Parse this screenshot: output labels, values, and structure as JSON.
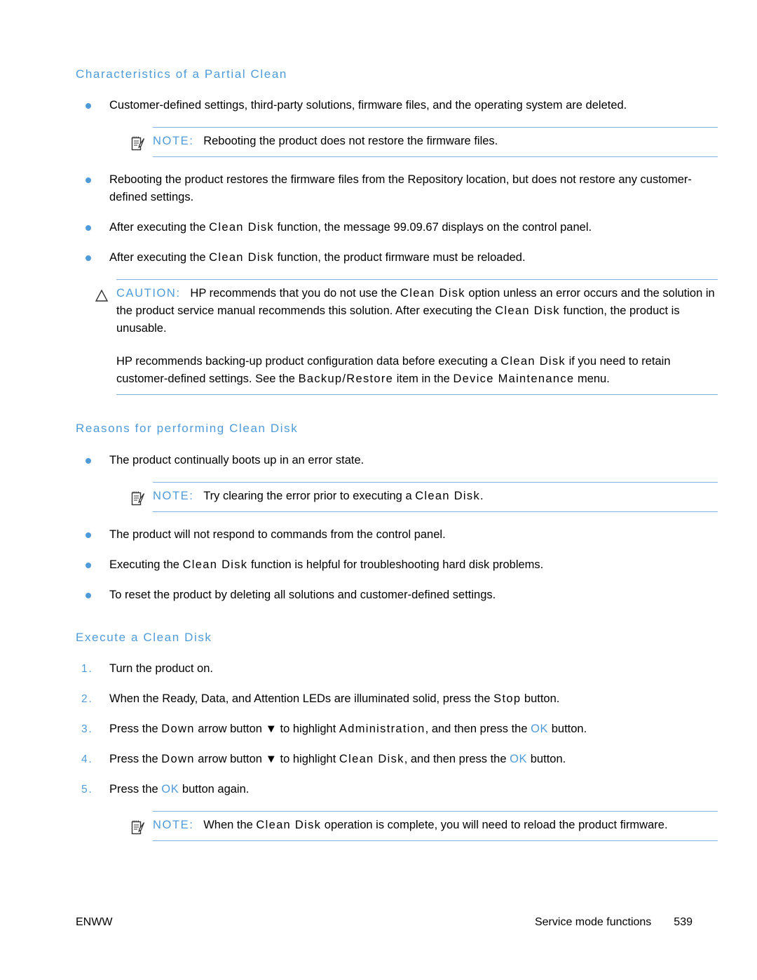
{
  "document": {
    "headings": {
      "characteristics": "Characteristics of a Partial Clean",
      "reasons": "Reasons for performing Clean Disk",
      "execute": "Execute a Clean Disk"
    },
    "characteristics_bullets": [
      {
        "pre": "Customer-defined settings, third-party solutions, firmware files, and the operating system are deleted.",
        "ui": "",
        "post": ""
      },
      {
        "pre": "Rebooting the product restores the firmware files from the Repository location, but does not restore any customer-defined settings.",
        "ui": "",
        "post": ""
      },
      {
        "pre": "After executing the ",
        "ui": "Clean Disk",
        "post": " function, the message 99.09.67 displays on the control panel."
      },
      {
        "pre": "After executing the ",
        "ui": "Clean Disk",
        "post": " function, the product firmware must be reloaded."
      }
    ],
    "note_reboot": {
      "icon": "note-clipboard-icon",
      "label": "NOTE:",
      "text": "Rebooting the product does not restore the firmware files."
    },
    "caution": {
      "icon": "caution-triangle-icon",
      "label": "CAUTION:",
      "p1_a": "HP recommends that you do not use the ",
      "p1_ui1": "Clean Disk",
      "p1_b": " option unless an error occurs and the solution in the product service manual recommends this solution. After executing the ",
      "p1_ui2": "Clean Disk",
      "p1_c": " function, the product is unusable.",
      "p2_a": "HP recommends backing-up product configuration data before executing a ",
      "p2_ui1": "Clean Disk",
      "p2_b": " if you need to retain customer-defined settings. See the ",
      "p2_ui2": "Backup/Restore",
      "p2_c": " item in the ",
      "p2_ui3": "Device Maintenance",
      "p2_d": " menu."
    },
    "reasons_bullets": [
      {
        "pre": "The product continually boots up in an error state.",
        "ui": "",
        "post": ""
      },
      {
        "pre": "The product will not respond to commands from the control panel.",
        "ui": "",
        "post": ""
      },
      {
        "pre": "Executing the ",
        "ui": "Clean Disk",
        "post": " function is helpful for troubleshooting hard disk problems."
      },
      {
        "pre": "To reset the product by deleting all solutions and customer-defined settings.",
        "ui": "",
        "post": ""
      }
    ],
    "note_clear_error": {
      "icon": "note-clipboard-icon",
      "label": "NOTE:",
      "pre": "Try clearing the error prior to executing a ",
      "ui": "Clean Disk",
      "post": "."
    },
    "execute_steps": [
      {
        "num": "1.",
        "segments": [
          {
            "t": "Turn the product on.",
            "s": "plain"
          }
        ]
      },
      {
        "num": "2.",
        "segments": [
          {
            "t": "When the Ready, Data, and Attention LEDs are illuminated solid, press the ",
            "s": "plain"
          },
          {
            "t": "Stop",
            "s": "ui"
          },
          {
            "t": " button.",
            "s": "plain"
          }
        ]
      },
      {
        "num": "3.",
        "segments": [
          {
            "t": "Press the ",
            "s": "plain"
          },
          {
            "t": "Down",
            "s": "ui"
          },
          {
            "t": " arrow button ",
            "s": "plain"
          },
          {
            "t": "▼",
            "s": "glyph"
          },
          {
            "t": " to highlight ",
            "s": "plain"
          },
          {
            "t": "Administration",
            "s": "ui"
          },
          {
            "t": ", and then press the ",
            "s": "plain"
          },
          {
            "t": "OK",
            "s": "ui-blue"
          },
          {
            "t": " button.",
            "s": "plain"
          }
        ]
      },
      {
        "num": "4.",
        "segments": [
          {
            "t": "Press the ",
            "s": "plain"
          },
          {
            "t": "Down",
            "s": "ui"
          },
          {
            "t": " arrow button ",
            "s": "plain"
          },
          {
            "t": "▼",
            "s": "glyph"
          },
          {
            "t": " to highlight ",
            "s": "plain"
          },
          {
            "t": "Clean Disk",
            "s": "ui"
          },
          {
            "t": ", and then press the ",
            "s": "plain"
          },
          {
            "t": "OK",
            "s": "ui-blue"
          },
          {
            "t": " button.",
            "s": "plain"
          }
        ]
      },
      {
        "num": "5.",
        "segments": [
          {
            "t": "Press the ",
            "s": "plain"
          },
          {
            "t": "OK",
            "s": "ui-blue"
          },
          {
            "t": " button again.",
            "s": "plain"
          }
        ]
      }
    ],
    "note_reload": {
      "icon": "note-clipboard-icon",
      "label": "NOTE:",
      "pre": "When the ",
      "ui": "Clean Disk",
      "post": " operation is complete, you will need to reload the product firmware."
    },
    "footer": {
      "left": "ENWW",
      "right": "Service mode functions",
      "page": "539"
    },
    "colors": {
      "heading_blue": "#4f9bd9",
      "rule_blue": "#7fb2e0",
      "bullet_blue": "#4f9bd9",
      "text_black": "#000000"
    }
  }
}
